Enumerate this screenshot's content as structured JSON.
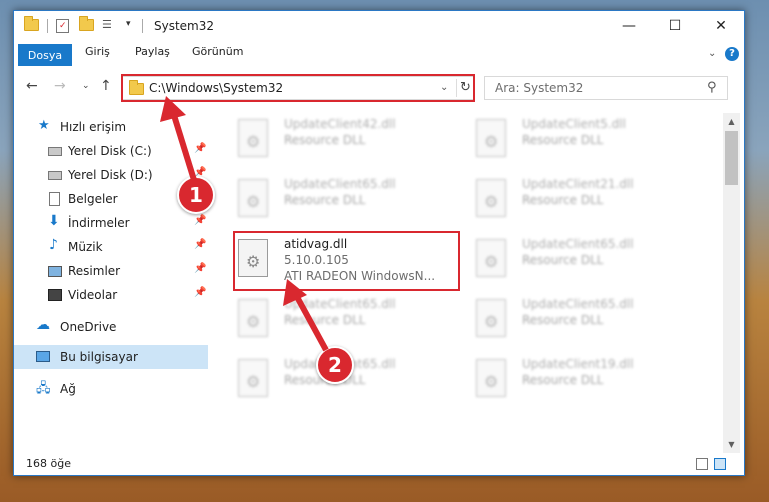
{
  "window": {
    "title": "System32",
    "minimize": "—",
    "maximize": "☐",
    "close": "✕"
  },
  "ribbon": {
    "tabs": [
      "Dosya",
      "Giriş",
      "Paylaş",
      "Görünüm"
    ],
    "help": "?"
  },
  "address": {
    "path": "C:\\Windows\\System32",
    "search_placeholder": "Ara: System32"
  },
  "sidebar": {
    "items": [
      {
        "label": "Hızlı erişim",
        "icon": "star-icon"
      },
      {
        "label": "Yerel Disk (C:)",
        "icon": "drive-icon",
        "pinned": true
      },
      {
        "label": "Yerel Disk (D:)",
        "icon": "drive-icon",
        "pinned": true
      },
      {
        "label": "Belgeler",
        "icon": "document-icon",
        "pinned": true
      },
      {
        "label": "İndirmeler",
        "icon": "download-icon",
        "pinned": true
      },
      {
        "label": "Müzik",
        "icon": "music-icon",
        "pinned": true
      },
      {
        "label": "Resimler",
        "icon": "picture-icon",
        "pinned": true
      },
      {
        "label": "Videolar",
        "icon": "video-icon",
        "pinned": true
      },
      {
        "label": "OneDrive",
        "icon": "cloud-icon"
      },
      {
        "label": "Bu bilgisayar",
        "icon": "computer-icon",
        "selected": true
      },
      {
        "label": "Ağ",
        "icon": "network-icon"
      }
    ]
  },
  "files": [
    {
      "name": "UpdateClient42.dll",
      "desc": "Resource DLL"
    },
    {
      "name": "UpdateClient5.dll",
      "desc": "Resource DLL"
    },
    {
      "name": "UpdateClient65.dll",
      "desc": "Resource DLL"
    },
    {
      "name": "UpdateClient21.dll",
      "desc": "Resource DLL"
    },
    {
      "name": "atidvag.dll",
      "version": "5.10.0.105",
      "desc": "ATI RADEON WindowsN...",
      "highlighted": true
    },
    {
      "name": "UpdateClient65.dll",
      "desc": "Resource DLL"
    },
    {
      "name": "UpdateClient65.dll",
      "desc": "Resource DLL"
    },
    {
      "name": "UpdateClient65.dll",
      "desc": "Resource DLL"
    },
    {
      "name": "UpdateClient65.dll",
      "desc": "Resource DLL"
    },
    {
      "name": "UpdateClient19.dll",
      "desc": "Resource DLL"
    }
  ],
  "status": {
    "count": "168 öğe"
  },
  "callouts": [
    "1",
    "2"
  ],
  "colors": {
    "accent": "#1979ca",
    "highlight_red": "#d9282f",
    "selection": "#cce4f7"
  }
}
